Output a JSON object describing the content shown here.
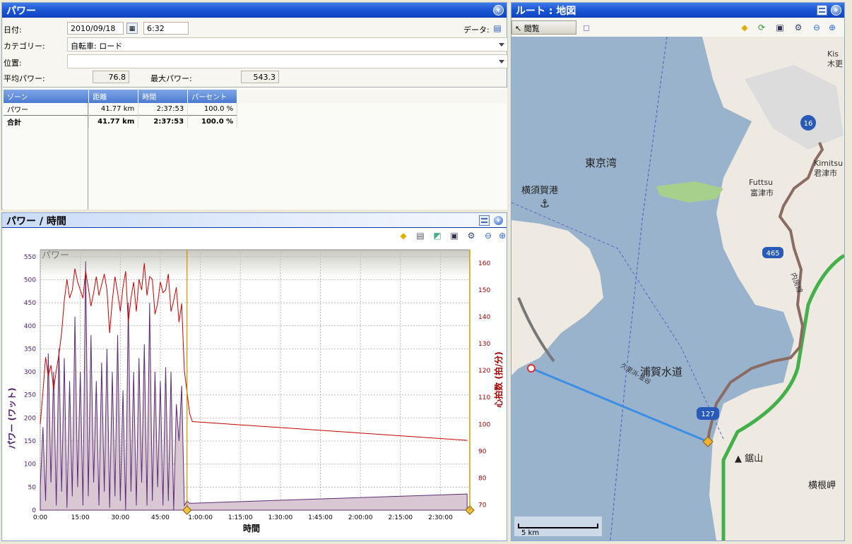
{
  "power_panel": {
    "title": "パワー",
    "date_label": "日付:",
    "date_value": "2010/09/18",
    "time_value": "6:32",
    "data_label": "データ:",
    "category_label": "カテゴリー:",
    "category_value": "自転車: ロード",
    "location_label": "位置:",
    "location_value": "",
    "avg_label": "平均パワー:",
    "avg_value": "76.8",
    "max_label": "最大パワー:",
    "max_value": "543.3",
    "zone_table": {
      "headers": [
        "ゾーン",
        "距離",
        "時間",
        "パーセント"
      ],
      "rows": [
        [
          "パワー",
          "41.77 km",
          "2:37:53",
          "100.0 %"
        ]
      ],
      "total": [
        "合計",
        "41.77 km",
        "2:37:53",
        "100.0 %"
      ]
    }
  },
  "chart_panel": {
    "title": "パワー / 時間",
    "inner_title": "パワー",
    "xlabel": "時間",
    "ylabel": "パワー (ワット)",
    "y2label": "心拍数 (拍/分)"
  },
  "chart_data": {
    "type": "area",
    "x_ticks": [
      "0:00",
      "15:00",
      "30:00",
      "45:00",
      "1:00:00",
      "1:15:00",
      "1:30:00",
      "1:45:00",
      "2:00:00",
      "2:15:00",
      "2:30:00"
    ],
    "y_ticks": [
      "0",
      "50",
      "100",
      "150",
      "200",
      "250",
      "300",
      "350",
      "400",
      "450",
      "500",
      "550"
    ],
    "y2_ticks": [
      "70",
      "80",
      "90",
      "100",
      "110",
      "120",
      "130",
      "140",
      "150",
      "160"
    ],
    "ylim": [
      0,
      565
    ],
    "y2lim": [
      68,
      165
    ],
    "xlim": [
      0,
      161
    ],
    "series": [
      {
        "name": "パワー",
        "x": [
          0,
          1,
          2,
          3,
          4,
          5,
          6,
          7,
          8,
          9,
          10,
          11,
          12,
          13,
          14,
          15,
          16,
          17,
          18,
          19,
          20,
          21,
          22,
          23,
          24,
          25,
          26,
          27,
          28,
          29,
          30,
          31,
          32,
          33,
          34,
          35,
          36,
          37,
          38,
          39,
          40,
          41,
          42,
          43,
          44,
          45,
          46,
          47,
          48,
          49,
          50,
          51,
          52,
          53,
          54,
          55,
          56,
          57,
          160
        ],
        "values": [
          50,
          180,
          20,
          340,
          60,
          300,
          10,
          350,
          40,
          330,
          5,
          280,
          30,
          420,
          50,
          300,
          10,
          540,
          30,
          380,
          60,
          280,
          10,
          320,
          40,
          350,
          5,
          300,
          30,
          380,
          20,
          260,
          0,
          450,
          40,
          300,
          10,
          330,
          60,
          360,
          10,
          450,
          20,
          300,
          50,
          280,
          10,
          310,
          20,
          300,
          0,
          230,
          150,
          270,
          10,
          20,
          15,
          15,
          35
        ]
      },
      {
        "name": "心拍数",
        "x": [
          0,
          1,
          2,
          3,
          4,
          5,
          6,
          7,
          8,
          9,
          10,
          11,
          12,
          13,
          14,
          15,
          16,
          17,
          18,
          19,
          20,
          21,
          22,
          23,
          24,
          25,
          26,
          27,
          28,
          29,
          30,
          31,
          32,
          33,
          34,
          35,
          36,
          37,
          38,
          39,
          40,
          41,
          42,
          43,
          44,
          45,
          46,
          47,
          48,
          49,
          50,
          51,
          52,
          53,
          54,
          55,
          56,
          57,
          160
        ],
        "values": [
          100,
          112,
          125,
          118,
          122,
          113,
          120,
          126,
          134,
          146,
          154,
          147,
          150,
          158,
          153,
          150,
          147,
          157,
          151,
          144,
          149,
          155,
          148,
          152,
          156,
          150,
          134,
          146,
          155,
          149,
          142,
          151,
          157,
          138,
          147,
          153,
          142,
          154,
          150,
          160,
          148,
          155,
          154,
          141,
          145,
          153,
          149,
          150,
          156,
          142,
          146,
          151,
          138,
          145,
          120,
          112,
          104,
          101,
          94
        ]
      }
    ],
    "legend": "none",
    "grid": true
  },
  "map_panel": {
    "title": "ルート : 地図",
    "browse_label": "閲覧",
    "labels": [
      "東京湾",
      "横須賀港",
      "浦賀水道",
      "Futtsu",
      "富津市",
      "Kimitsu",
      "君津市",
      "鋸山",
      "横根岬",
      "久里浜-金谷",
      "内房線",
      "465",
      "16",
      "127",
      "Kis",
      "木更"
    ],
    "scale": "5 km"
  }
}
